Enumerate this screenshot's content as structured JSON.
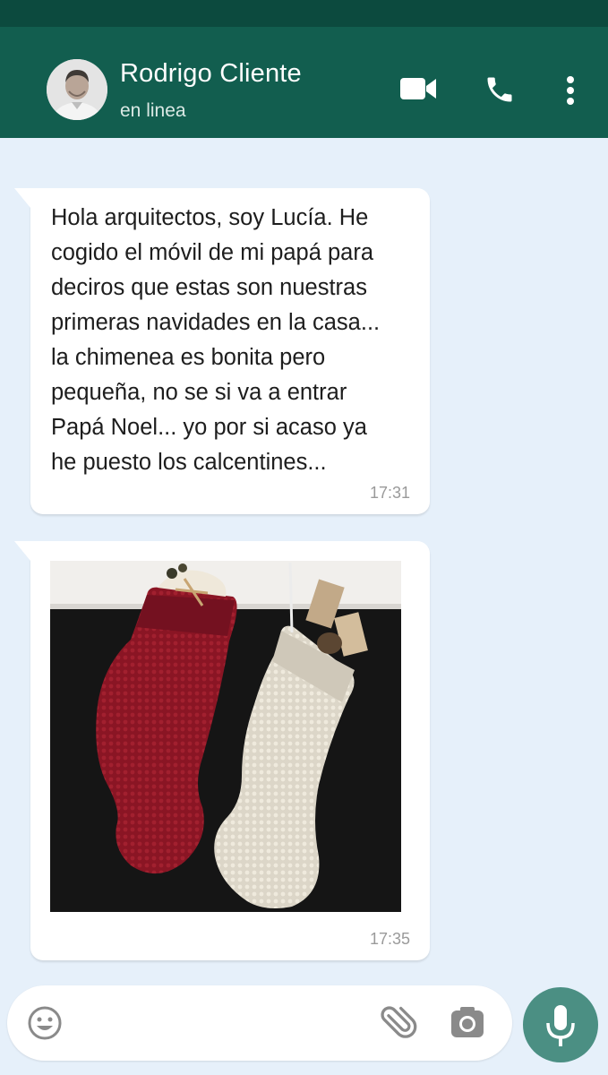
{
  "header": {
    "contact_name": "Rodrigo Cliente",
    "contact_status": "en linea",
    "icons": [
      "video-call-icon",
      "phone-icon",
      "more-options-icon"
    ],
    "bg_color": "#125e4f"
  },
  "messages": [
    {
      "type": "text",
      "text": "Hola arquitectos, soy Lucía. He\ncogido el móvil de mi papá para\ndeciros que estas son nuestras\nprimeras navidades en la casa...\nla chimenea es bonita pero\npequeña, no se si va a entrar\nPapá Noel... yo por si acaso ya\nhe puesto los calcentines...",
      "time": "17:31"
    },
    {
      "type": "image",
      "image_alt": "Christmas stockings hanging from a mantel",
      "time": "17:35"
    }
  ],
  "composer": {
    "placeholder": "",
    "icons": [
      "emoji-icon",
      "attach-icon",
      "camera-icon",
      "mic-icon"
    ],
    "mic_color": "#4b8f83"
  }
}
